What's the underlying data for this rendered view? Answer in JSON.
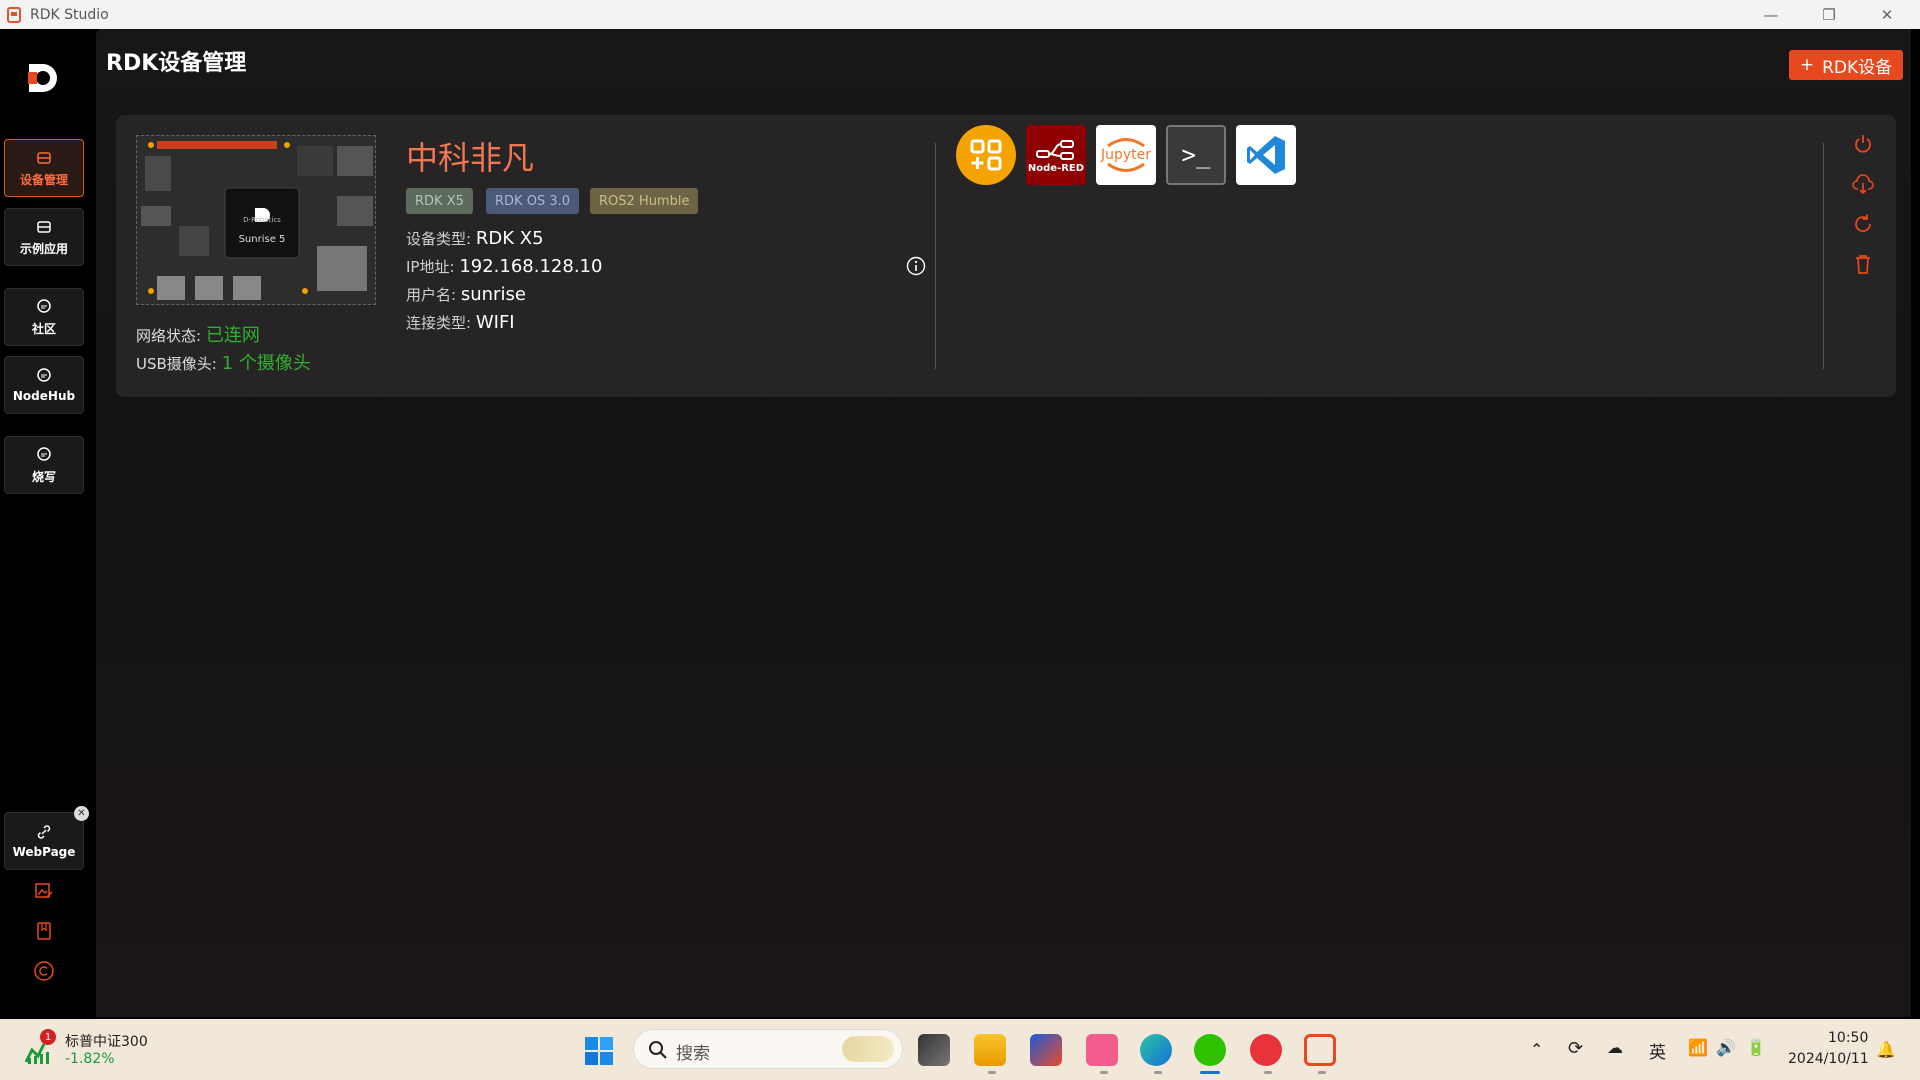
{
  "window": {
    "title": "RDK Studio"
  },
  "nav": {
    "items": [
      {
        "label": "设备管理",
        "icon": "box-icon"
      },
      {
        "label": "示例应用",
        "icon": "box-icon"
      },
      {
        "label": "社区",
        "icon": "chat-icon"
      },
      {
        "label": "NodeHub",
        "icon": "chat-icon"
      },
      {
        "label": "烧写",
        "icon": "chat-icon"
      }
    ],
    "webpage": {
      "label": "WebPage",
      "icon": "link-icon"
    },
    "bottom_icons": [
      "image-edit-icon",
      "book-icon",
      "copyright-icon"
    ]
  },
  "header": {
    "title": "RDK设备管理",
    "add_button_label": "RDK设备",
    "add_button_icon": "+"
  },
  "device": {
    "name": "中科非凡",
    "board_label": "Sunrise 5",
    "board_small": "D-Robotics",
    "tags": [
      "RDK X5",
      "RDK OS 3.0",
      "ROS2 Humble"
    ],
    "network_status_label": "网络状态:",
    "network_status_value": "已连网",
    "usb_camera_label": "USB摄像头:",
    "usb_camera_value": "1 个摄像头",
    "type_label": "设备类型:",
    "type_value": "RDK X5",
    "ip_label": "IP地址:",
    "ip_value": "192.168.128.10",
    "user_label": "用户名:",
    "user_value": "sunrise",
    "conn_label": "连接类型:",
    "conn_value": "WIFI"
  },
  "tools": [
    {
      "name": "apps-grid",
      "color": "#f5a300"
    },
    {
      "name": "node-red",
      "label": "Node-RED",
      "color": "#8f0000"
    },
    {
      "name": "jupyter",
      "label": "Jupyter",
      "color": "#ffffff"
    },
    {
      "name": "terminal",
      "label": ">_",
      "color": "#3a3a3a"
    },
    {
      "name": "vscode",
      "color": "#ffffff"
    }
  ],
  "actions": [
    "power-icon",
    "cloud-download-icon",
    "refresh-icon",
    "trash-icon"
  ],
  "taskbar": {
    "stock_name": "标普中证300",
    "stock_change": "-1.82%",
    "stock_badge": "1",
    "search_placeholder": "搜索",
    "ime": "英",
    "time": "10:50",
    "date": "2024/10/11"
  },
  "colors": {
    "accent": "#e8481e",
    "ok": "#2fb12f",
    "name": "#f07752"
  }
}
